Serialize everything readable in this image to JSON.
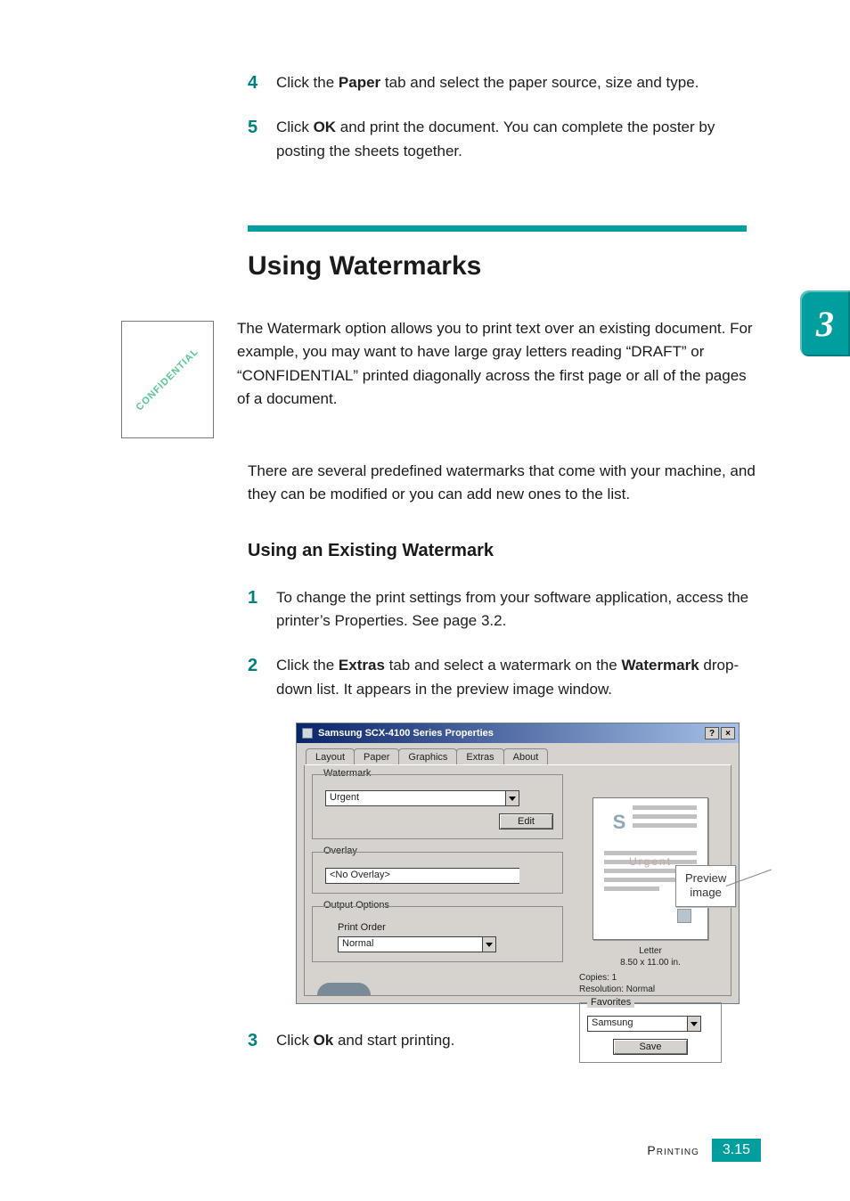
{
  "steps_top": [
    {
      "num": "4",
      "prefix": "Click the ",
      "bold": "Paper",
      "suffix": " tab and select the paper source, size and type."
    },
    {
      "num": "5",
      "prefix": "Click ",
      "bold": "OK",
      "suffix": " and print the document. You can complete the poster by posting the sheets together."
    }
  ],
  "section_title": "Using Watermarks",
  "side_tab": "3",
  "thumb_wm": "CONFIDENTIAL",
  "intro_p1": "The Watermark option allows you to print text over an existing document. For example, you may want to have large gray letters reading “DRAFT” or “CONFIDENTIAL” printed diagonally across the first page or all of the pages of a document.",
  "intro_p2": "There are several predefined watermarks that come with your machine, and they can be modified or you can add new ones to the list.",
  "sub_title": "Using an Existing Watermark",
  "steps_mid": [
    {
      "num": "1",
      "html": "To change the print settings from your software application, access the printer’s Properties. See page 3.2."
    },
    {
      "num": "2",
      "prefix": "Click the ",
      "bold": "Extras",
      "mid": " tab and select a watermark on the ",
      "bold2": "Watermark",
      "suffix": " drop-down list. It appears in the preview image window."
    }
  ],
  "dialog": {
    "title": "Samsung SCX-4100 Series Properties",
    "tabs": [
      "Layout",
      "Paper",
      "Graphics",
      "Extras",
      "About"
    ],
    "active_tab": "Extras",
    "watermark_group": "Watermark",
    "watermark_value": "Urgent",
    "edit_btn": "Edit",
    "overlay_group": "Overlay",
    "overlay_value": "<No Overlay>",
    "output_group": "Output Options",
    "print_order_label": "Print Order",
    "print_order_value": "Normal",
    "preview_wm": "Urgent",
    "paper_name": "Letter",
    "paper_dims": "8.50 x 11.00 in.",
    "copies": "Copies: 1",
    "resolution": "Resolution: Normal",
    "favorites_group": "Favorites",
    "favorites_value": "Samsung",
    "save_btn": "Save"
  },
  "callout": {
    "l1": "Preview",
    "l2": "image"
  },
  "step3": {
    "num": "3",
    "prefix": "Click ",
    "bold": "Ok",
    "suffix": " and start printing."
  },
  "footer": {
    "label": "Printing",
    "page": "3.15"
  }
}
